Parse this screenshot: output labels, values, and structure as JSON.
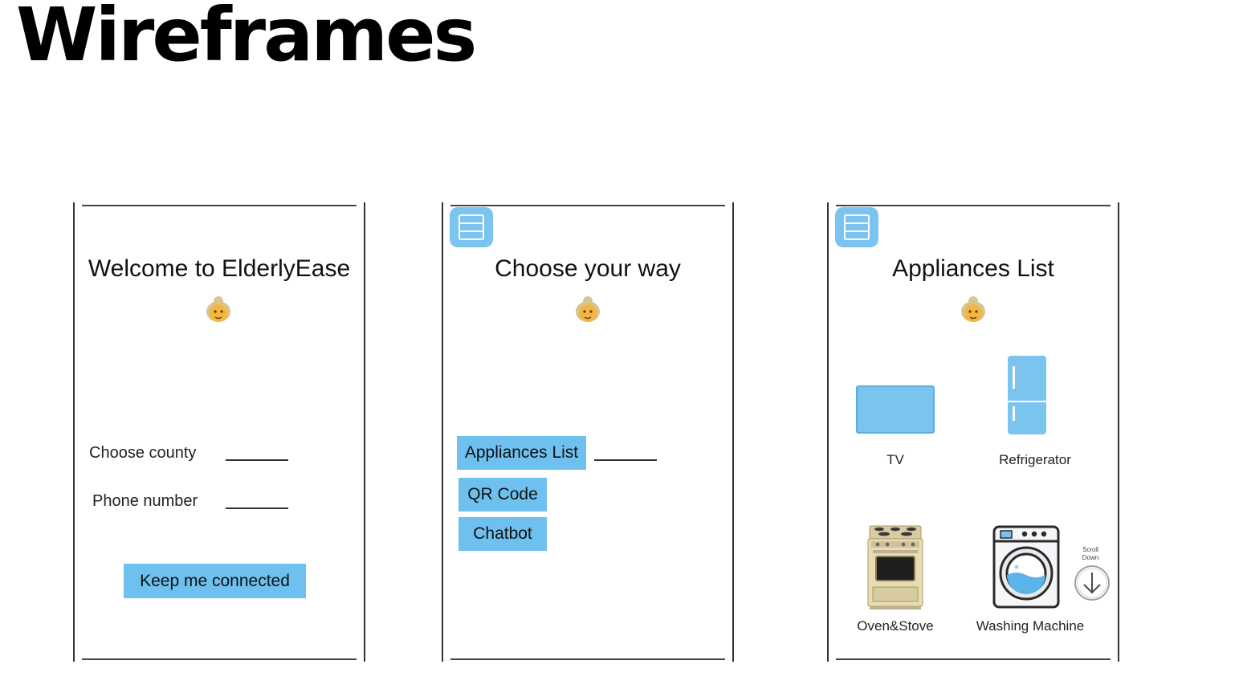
{
  "page": {
    "title": "Wireframes"
  },
  "screens": {
    "welcome": {
      "heading": "Welcome to ElderlyEase",
      "county_label": "Choose county",
      "phone_label": "Phone number",
      "connect_button": "Keep me connected"
    },
    "choose": {
      "heading": "Choose your way",
      "options": [
        "Appliances List",
        "QR Code",
        "Chatbot"
      ]
    },
    "appliances": {
      "heading": "Appliances List",
      "items": [
        "TV",
        "Refrigerator",
        "Oven&Stove",
        "Washing Machine"
      ],
      "scroll_hint": "Scroll Down"
    }
  },
  "colors": {
    "accent": "#6ec0ef",
    "menu": "#7cc4f0"
  },
  "icons": [
    "menu-icon",
    "elderly-woman-icon",
    "tv-icon",
    "refrigerator-icon",
    "oven-icon",
    "washing-machine-icon",
    "arrow-down-icon"
  ]
}
